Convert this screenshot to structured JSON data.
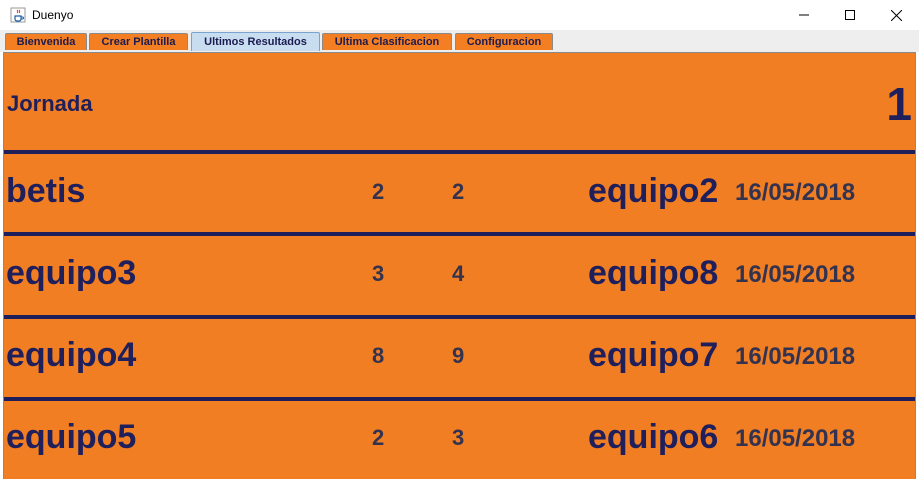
{
  "window": {
    "title": "Duenyo",
    "icon": "java-icon",
    "controls": [
      "minimize-icon",
      "maximize-icon",
      "close-icon"
    ]
  },
  "tabs": [
    {
      "label": "Bienvenida",
      "active": false
    },
    {
      "label": "Crear Plantilla",
      "active": false
    },
    {
      "label": "Ultimos Resultados",
      "active": true
    },
    {
      "label": "Ultima Clasificacion",
      "active": false
    },
    {
      "label": "Configuracion",
      "active": false
    }
  ],
  "jornada": {
    "label": "Jornada",
    "number": "1"
  },
  "matches": [
    {
      "home": "betis",
      "home_score": "2",
      "away_score": "2",
      "away": "equipo2",
      "date": "16/05/2018"
    },
    {
      "home": "equipo3",
      "home_score": "3",
      "away_score": "4",
      "away": "equipo8",
      "date": "16/05/2018"
    },
    {
      "home": "equipo4",
      "home_score": "8",
      "away_score": "9",
      "away": "equipo7",
      "date": "16/05/2018"
    },
    {
      "home": "equipo5",
      "home_score": "2",
      "away_score": "3",
      "away": "equipo6",
      "date": "16/05/2018"
    }
  ],
  "colors": {
    "panel": "#f17e22",
    "text": "#1f1f5c",
    "separator": "#1e1e5a",
    "active_tab": "#c9ddf1"
  }
}
